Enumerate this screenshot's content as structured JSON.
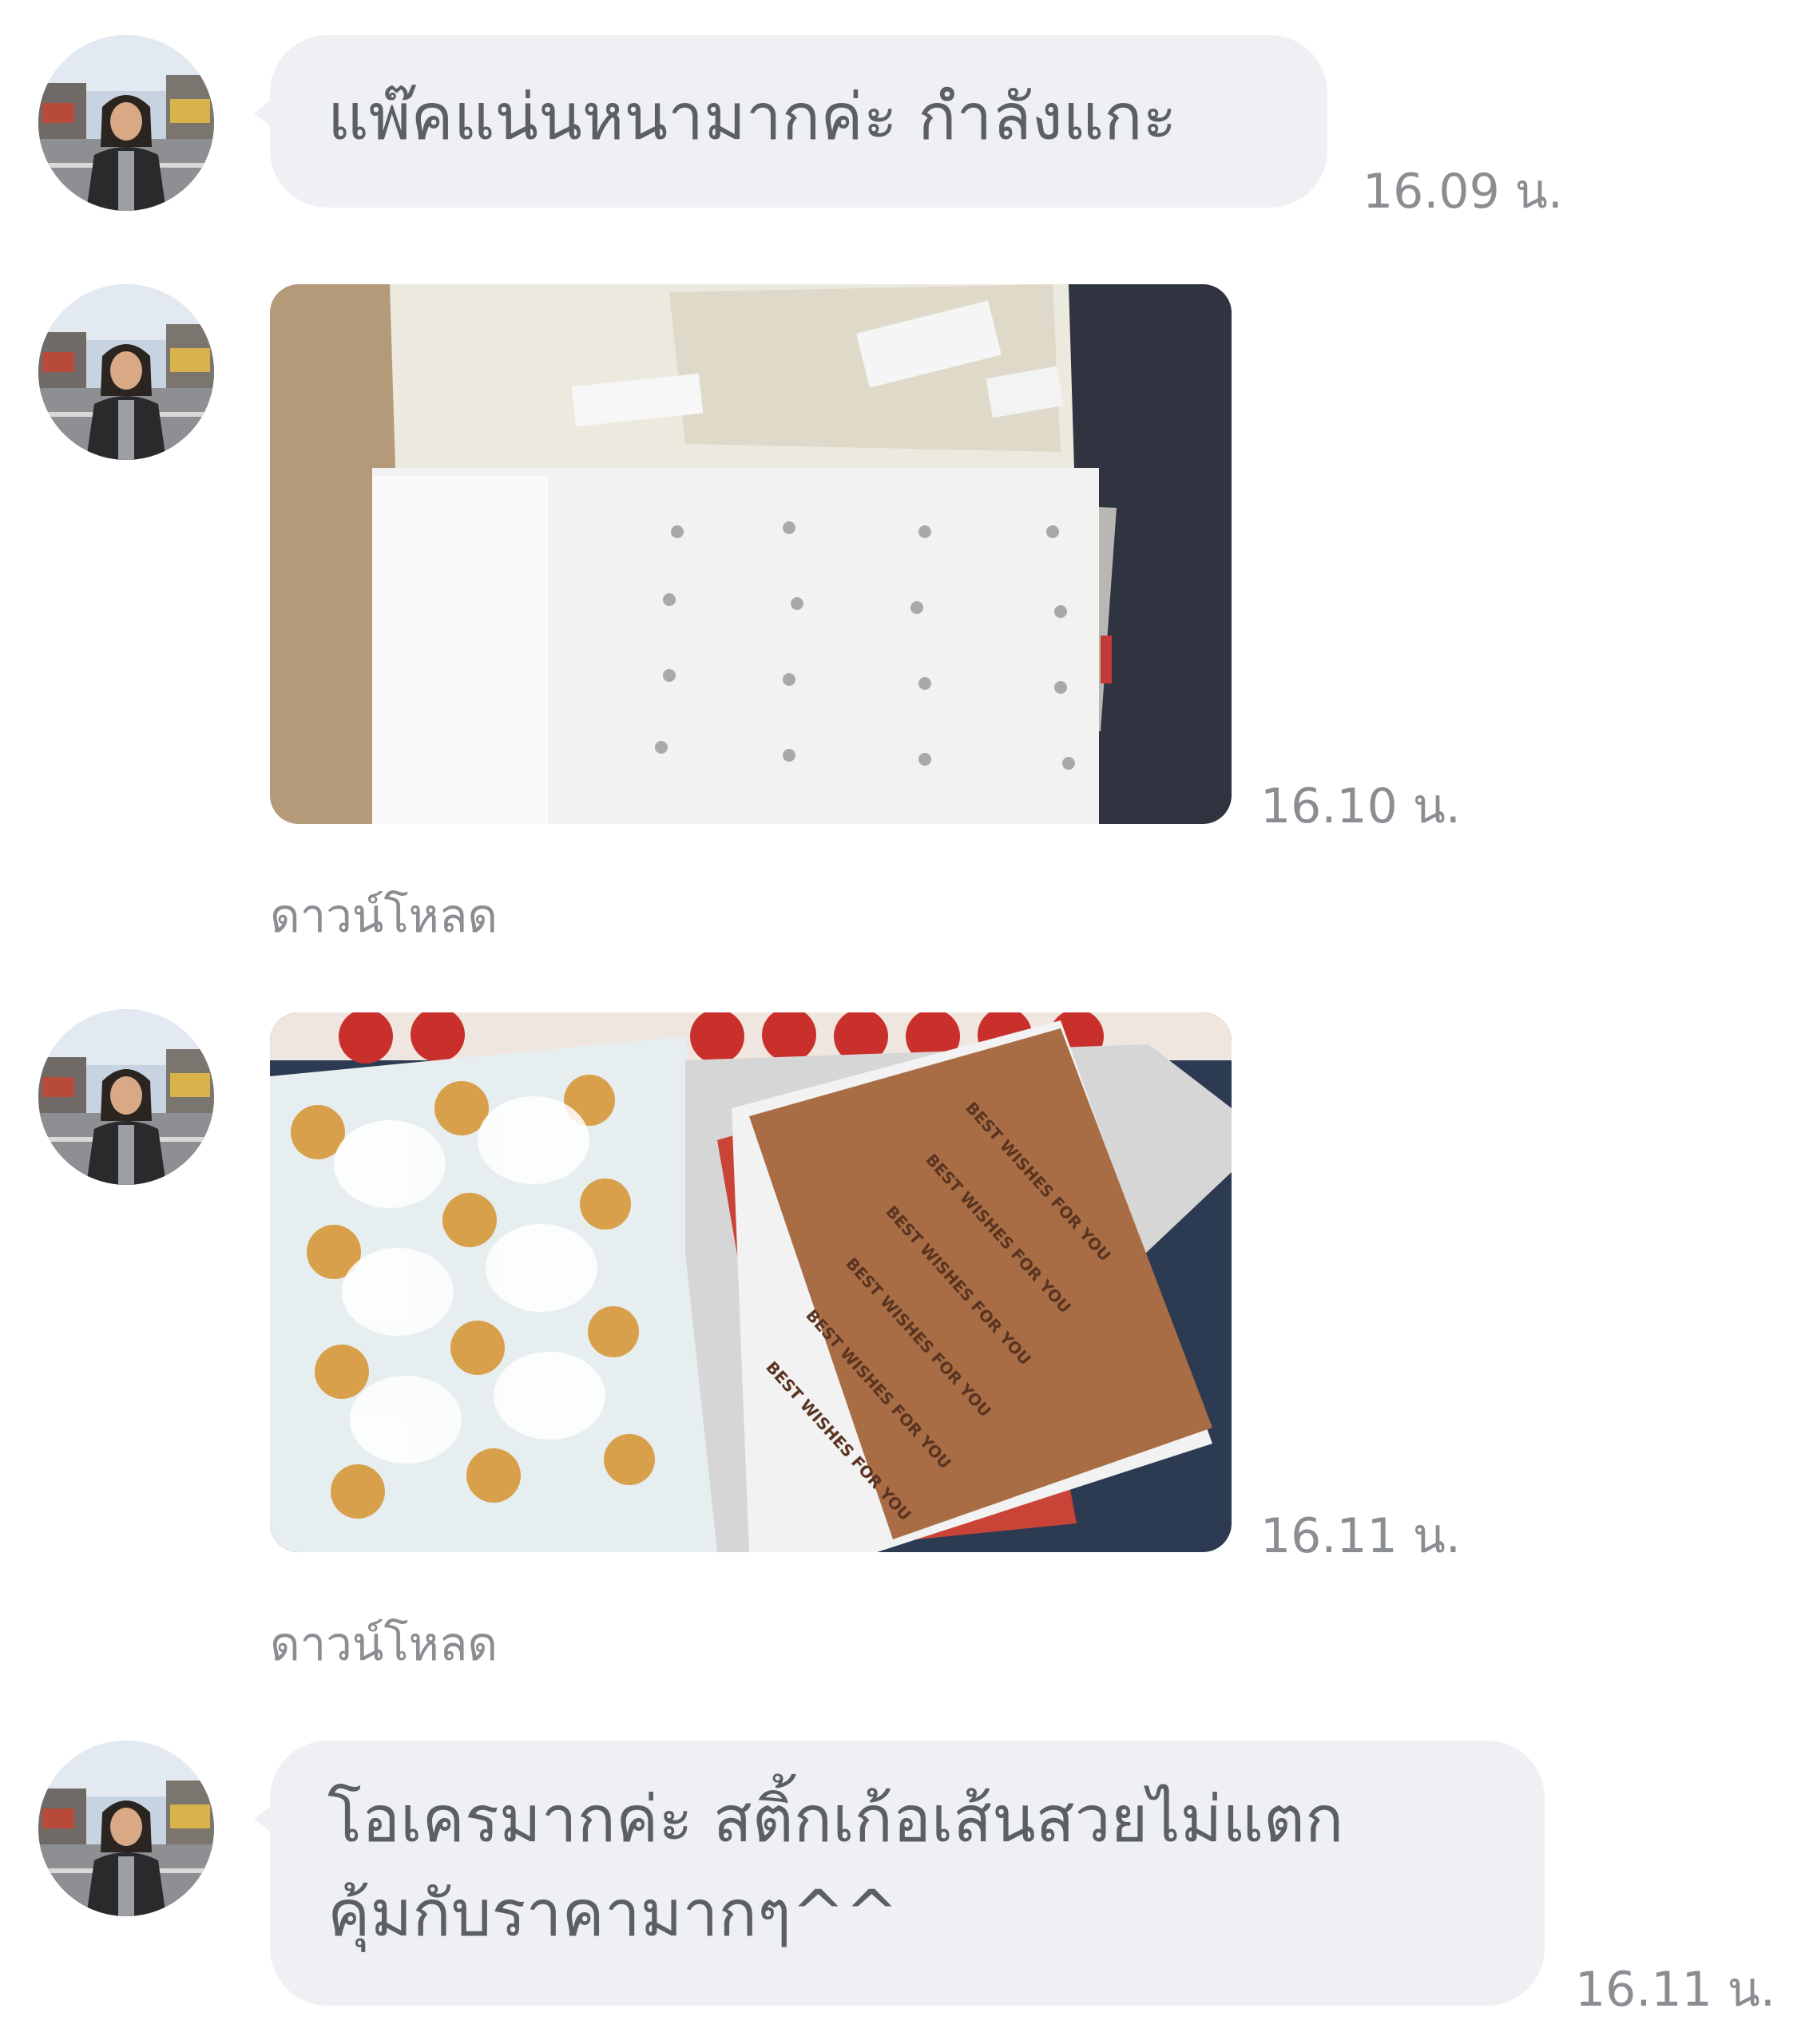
{
  "messages": [
    {
      "type": "text",
      "text": "แพ๊คแน่นหนามากค่ะ กำลังแกะ",
      "time": "16.09 น."
    },
    {
      "type": "image",
      "time": "16.10 น.",
      "download_label": "ดาวน์โหลด"
    },
    {
      "type": "image",
      "time": "16.11 น.",
      "download_label": "ดาวน์โหลด",
      "photo_text": "BEST WISHES FOR YOU"
    },
    {
      "type": "text",
      "text": "โอเครมากค่ะ สติ้กเก้อเส้นสวยไม่แตก\nคุ้มกับราคามากๆ^^",
      "time": "16.11 น."
    }
  ],
  "colors": {
    "bubble": "#eef0f3",
    "text": "#5c5f64",
    "meta": "#8a8d91",
    "background": "#ffffff"
  }
}
